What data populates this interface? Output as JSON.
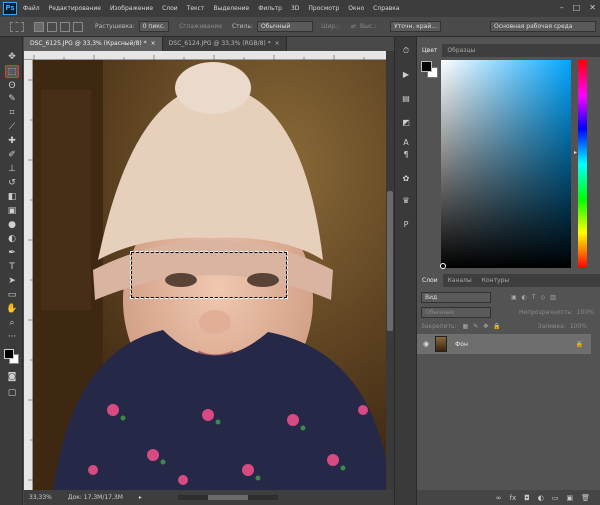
{
  "app": {
    "logo": "Ps"
  },
  "menu": [
    "Файл",
    "Редактирование",
    "Изображение",
    "Слои",
    "Текст",
    "Выделение",
    "Фильтр",
    "3D",
    "Просмотр",
    "Окно",
    "Справка"
  ],
  "window_controls": {
    "minimize": "–",
    "maximize": "□",
    "close": "✕"
  },
  "options": {
    "feather_label": "Растушевка:",
    "feather_value": "0 пикс.",
    "antialias_label": "Сглаживание",
    "style_label": "Стиль:",
    "style_value": "Обычный",
    "width_label": "Шир.:",
    "height_label": "Выс.:",
    "refine_button": "Уточн. край...",
    "workspace": "Основная рабочая среда"
  },
  "document_tabs": [
    {
      "title": "DSC_6125.JPG @ 33,3% (Красный/8) *",
      "close": "×",
      "active": true
    },
    {
      "title": "DSC_6124.JPG @ 33,3% (RGB/8) *",
      "close": "×",
      "active": false
    }
  ],
  "status": {
    "zoom": "33,33%",
    "doc": "Док: 17,3M/17,3M"
  },
  "color_panel": {
    "tab_color": "Цвет",
    "tab_swatches": "Образцы"
  },
  "layers_panel": {
    "tabs": [
      "Слои",
      "Каналы",
      "Контуры"
    ],
    "filter_kind": "Вид",
    "blend_mode": "Обычные",
    "opacity_label": "Непрозрачность:",
    "opacity_value": "100%",
    "lock_label": "Закрепить:",
    "fill_label": "Заливка:",
    "fill_value": "100%",
    "layer_name": "Фон"
  },
  "colors": {
    "accent_red": "#e8392a",
    "picker_hue": "#00a6ff",
    "panel_bg": "#535353"
  }
}
